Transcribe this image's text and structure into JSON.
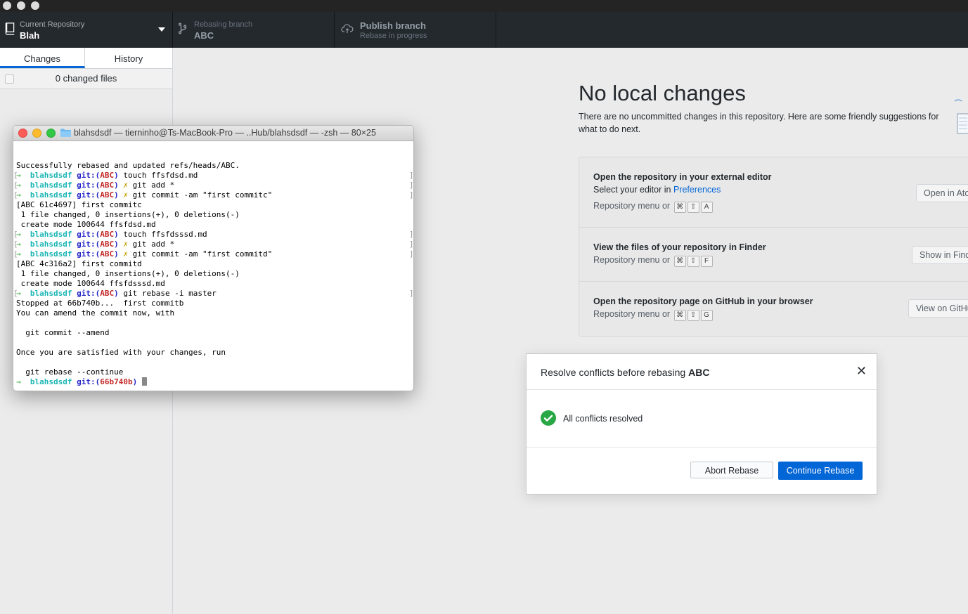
{
  "toolbar": {
    "repo": {
      "small": "Current Repository",
      "big": "Blah"
    },
    "branch": {
      "small": "Rebasing branch",
      "big": "ABC"
    },
    "publish": {
      "big": "Publish branch",
      "small": "Rebase in progress"
    }
  },
  "sidebar": {
    "tabs": [
      "Changes",
      "History"
    ],
    "active_tab": "Changes",
    "changed_files": "0 changed files"
  },
  "main": {
    "title": "No local changes",
    "description": "There are no uncommitted changes in this repository. Here are some friendly suggestions for what to do next.",
    "suggestions": [
      {
        "title": "Open the repository in your external editor",
        "sub_prefix": "Select your editor in ",
        "sub_link": "Preferences",
        "meta": "Repository menu or",
        "keys": [
          "⌘",
          "⇧",
          "A"
        ],
        "button": "Open in Atom"
      },
      {
        "title": "View the files of your repository in Finder",
        "meta": "Repository menu or",
        "keys": [
          "⌘",
          "⇧",
          "F"
        ],
        "button": "Show in Finder"
      },
      {
        "title": "Open the repository page on GitHub in your browser",
        "meta": "Repository menu or",
        "keys": [
          "⌘",
          "⇧",
          "G"
        ],
        "button": "View on GitHub"
      }
    ]
  },
  "dialog": {
    "title_prefix": "Resolve conflicts before rebasing ",
    "branch": "ABC",
    "status": "All conflicts resolved",
    "abort_label": "Abort Rebase",
    "continue_label": "Continue Rebase",
    "close_glyph": "✕"
  },
  "terminal": {
    "title": "blahsdsdf — tierninho@Ts-MacBook-Pro — ..Hub/blahsdsdf — -zsh — 80×25",
    "lines": [
      {
        "type": "out",
        "text": "Successfully rebased and updated refs/heads/ABC."
      },
      {
        "type": "prompt",
        "dir": "blahsdsdf",
        "branch": "ABC",
        "dirty": false,
        "cmd": "touch ffsfdsd.md"
      },
      {
        "type": "prompt",
        "dir": "blahsdsdf",
        "branch": "ABC",
        "dirty": true,
        "cmd": "git add *"
      },
      {
        "type": "prompt",
        "dir": "blahsdsdf",
        "branch": "ABC",
        "dirty": true,
        "cmd": "git commit -am \"first commitc\""
      },
      {
        "type": "out",
        "text": "[ABC 61c4697] first commitc"
      },
      {
        "type": "out",
        "text": " 1 file changed, 0 insertions(+), 0 deletions(-)"
      },
      {
        "type": "out",
        "text": " create mode 100644 ffsfdsd.md"
      },
      {
        "type": "prompt",
        "dir": "blahsdsdf",
        "branch": "ABC",
        "dirty": false,
        "cmd": "touch ffsfdsssd.md"
      },
      {
        "type": "prompt",
        "dir": "blahsdsdf",
        "branch": "ABC",
        "dirty": true,
        "cmd": "git add *"
      },
      {
        "type": "prompt",
        "dir": "blahsdsdf",
        "branch": "ABC",
        "dirty": true,
        "cmd": "git commit -am \"first commitd\""
      },
      {
        "type": "out",
        "text": "[ABC 4c316a2] first commitd"
      },
      {
        "type": "out",
        "text": " 1 file changed, 0 insertions(+), 0 deletions(-)"
      },
      {
        "type": "out",
        "text": " create mode 100644 ffsfdsssd.md"
      },
      {
        "type": "prompt",
        "dir": "blahsdsdf",
        "branch": "ABC",
        "dirty": false,
        "cmd": "git rebase -i master"
      },
      {
        "type": "out",
        "text": "Stopped at 66b740b...  first commitb"
      },
      {
        "type": "out",
        "text": "You can amend the commit now, with"
      },
      {
        "type": "out",
        "text": ""
      },
      {
        "type": "out",
        "text": "  git commit --amend"
      },
      {
        "type": "out",
        "text": ""
      },
      {
        "type": "out",
        "text": "Once you are satisfied with your changes, run"
      },
      {
        "type": "out",
        "text": ""
      },
      {
        "type": "out",
        "text": "  git rebase --continue"
      },
      {
        "type": "current",
        "dir": "blahsdsdf",
        "branch": "66b740b",
        "dirty": false,
        "cmd": ""
      }
    ]
  },
  "colors": {
    "toolbar_bg": "#24292e",
    "accent_blue": "#0366d6",
    "success_green": "#28a745"
  }
}
